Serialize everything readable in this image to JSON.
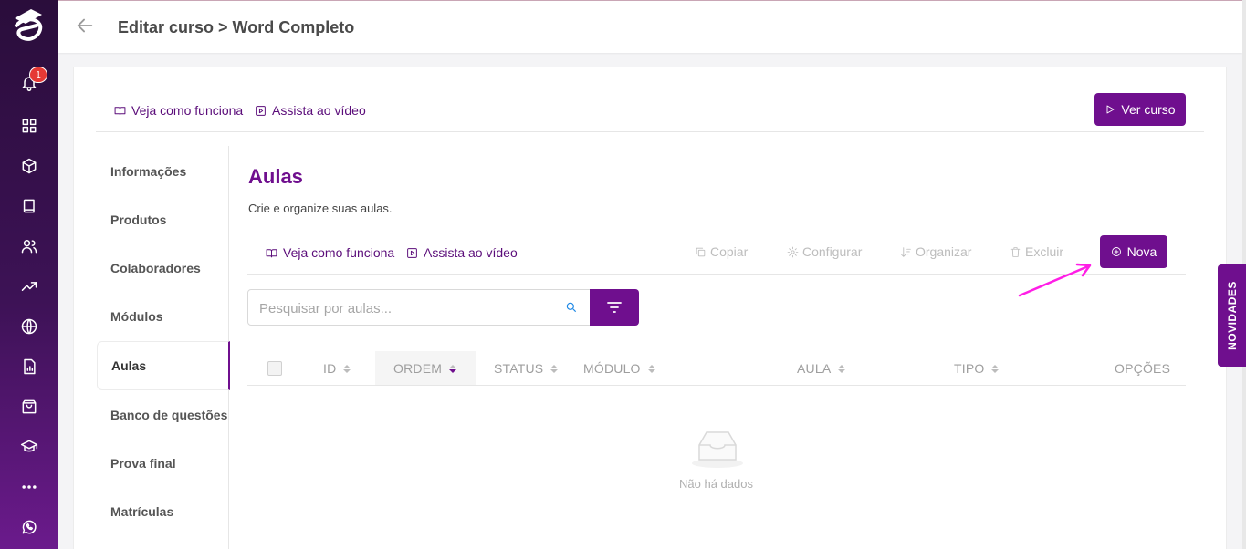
{
  "header": {
    "title": "Editar curso > Word Completo"
  },
  "rail": {
    "notification_count": "1",
    "icons": [
      "logo-icon",
      "bell-icon",
      "grid-icon",
      "box-icon",
      "book-icon",
      "users-icon",
      "trending-icon",
      "globe-icon",
      "report-icon",
      "bag-icon",
      "graduation-cap-icon",
      "more-icon",
      "whatsapp-icon"
    ]
  },
  "top_links": {
    "how_it_works": "Veja como funciona",
    "watch_video": "Assista ao vídeo"
  },
  "view_course_button": "Ver curso",
  "side_menu": {
    "items": [
      "Informações",
      "Produtos",
      "Colaboradores",
      "Módulos",
      "Aulas",
      "Banco de questões",
      "Prova final",
      "Matrículas"
    ],
    "active": "Aulas"
  },
  "section": {
    "title": "Aulas",
    "subtitle": "Crie e organize suas aulas."
  },
  "section_links": {
    "how_it_works": "Veja como funciona",
    "watch_video": "Assista ao vídeo"
  },
  "toolbar": {
    "copy": "Copiar",
    "configure": "Configurar",
    "organize": "Organizar",
    "delete": "Excluir",
    "new": "Nova"
  },
  "search": {
    "placeholder": "Pesquisar por aulas...",
    "value": ""
  },
  "table": {
    "columns": [
      "ID",
      "ORDEM",
      "STATUS",
      "MÓDULO",
      "AULA",
      "TIPO",
      "OPÇÕES"
    ],
    "sorted_column": "ORDEM",
    "sort_direction": "descending",
    "rows": [],
    "empty_text": "Não há dados"
  },
  "novidades_tab": "NOVIDADES",
  "colors": {
    "brand": "#6f0f8e",
    "rail_top": "#2a0d3b",
    "rail_bottom": "#6b1a8c",
    "badge": "#e53935",
    "annotation_arrow": "#ff1ee6"
  }
}
